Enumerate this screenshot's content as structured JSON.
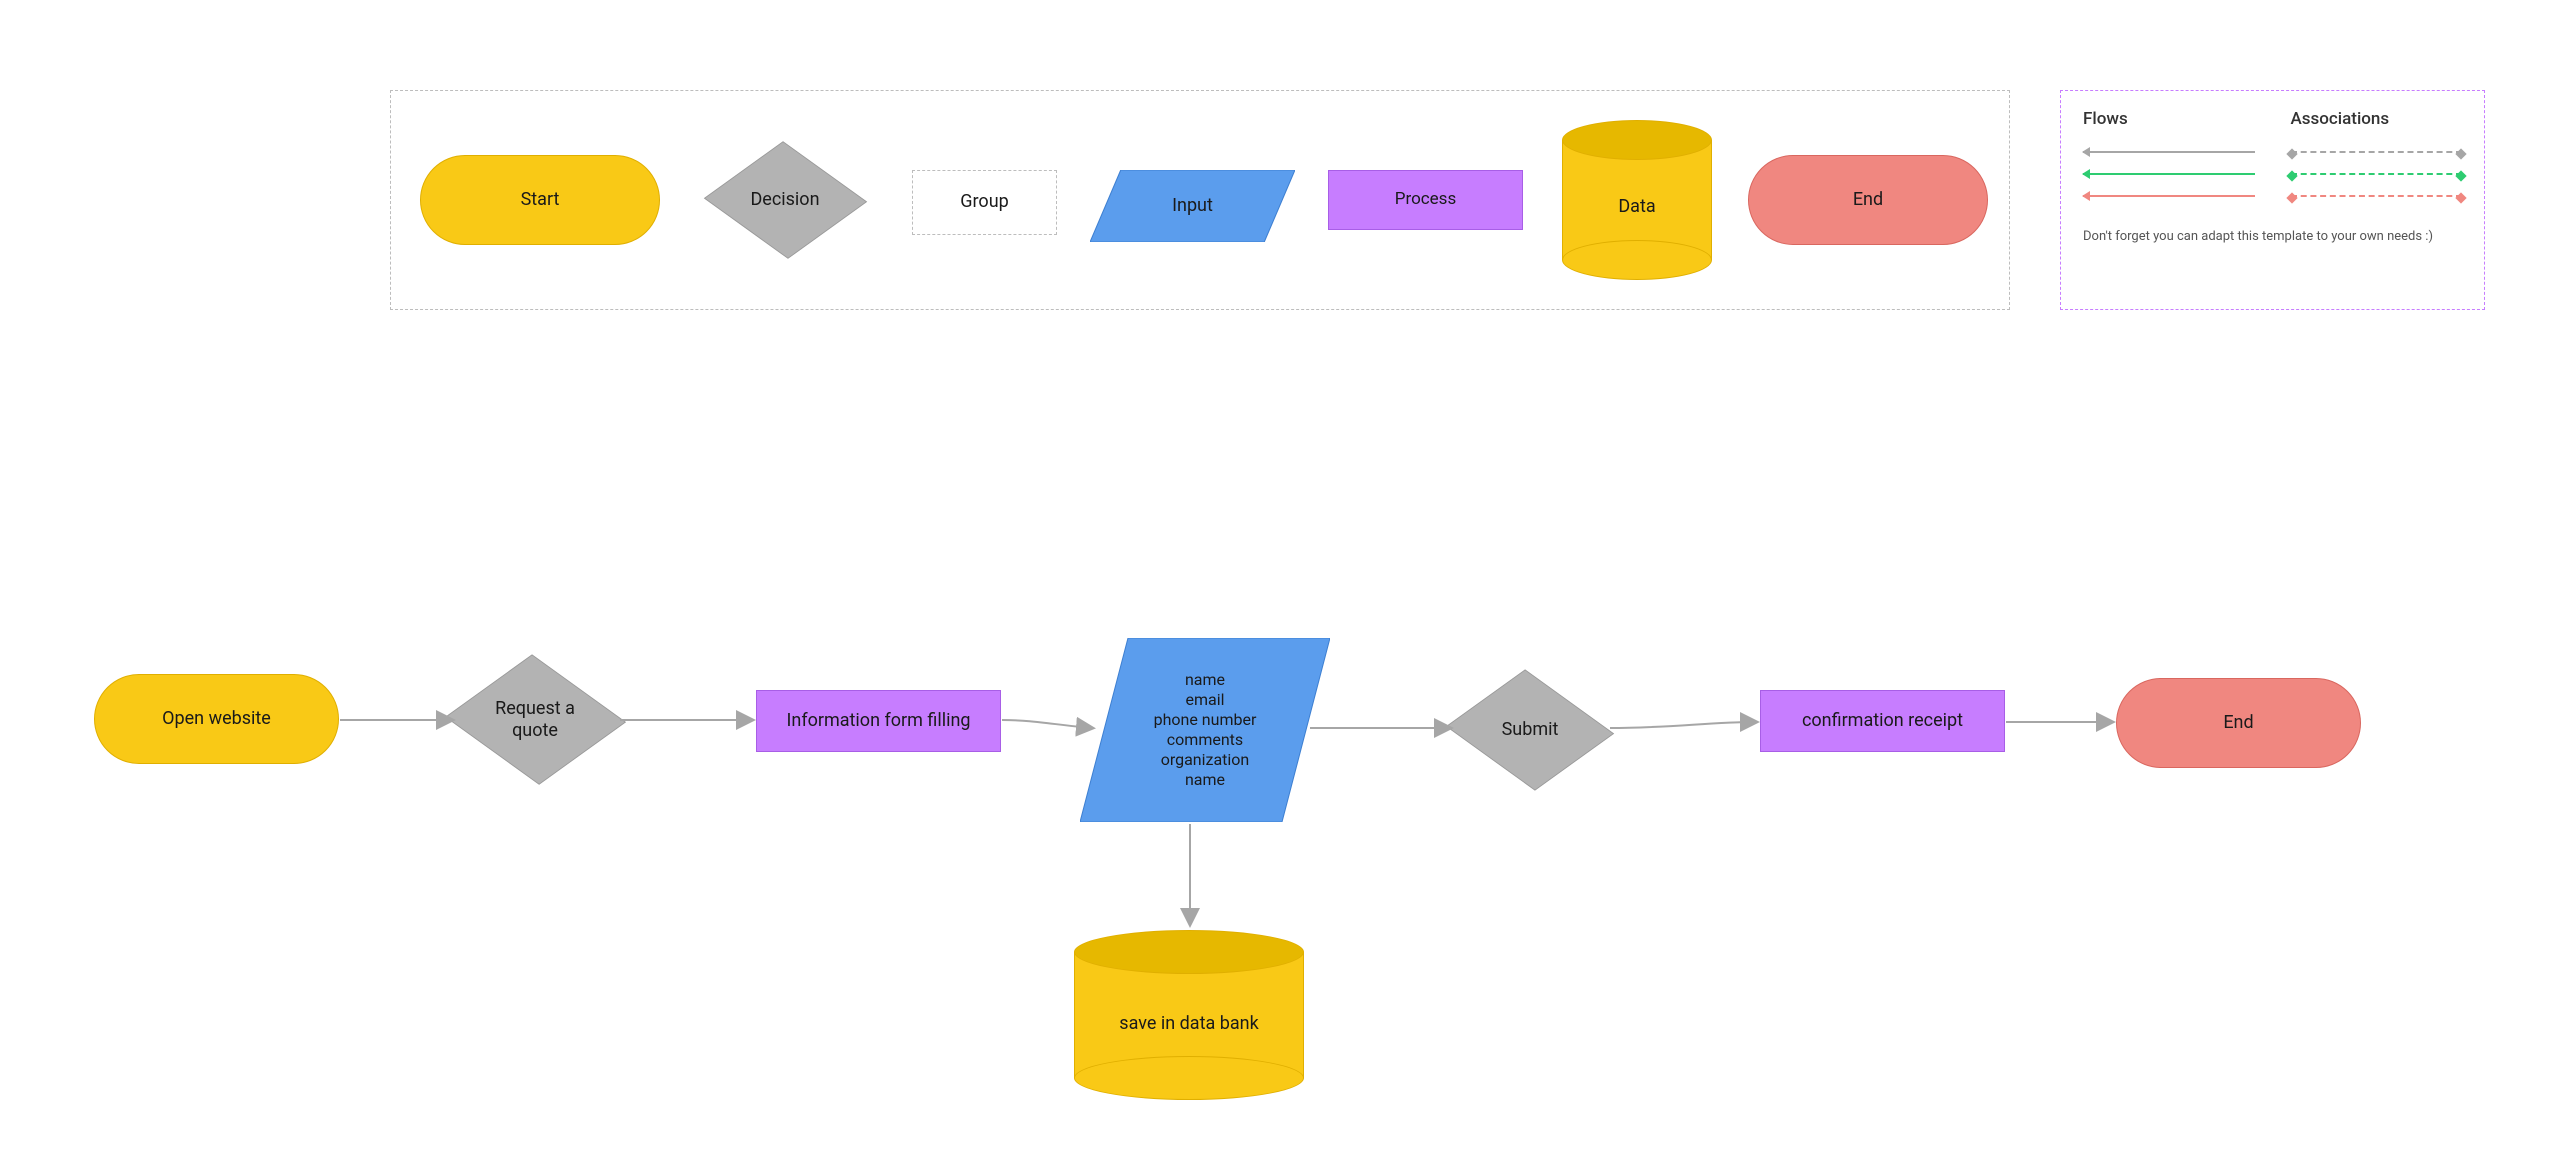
{
  "legend": {
    "shapes": {
      "start": "Start",
      "decision": "Decision",
      "group": "Group",
      "input": "Input",
      "process": "Process",
      "data": "Data",
      "end": "End"
    },
    "info": {
      "flows_header": "Flows",
      "associations_header": "Associations",
      "note": "Don't forget you can adapt this template to your own needs :)"
    }
  },
  "flow": {
    "open_website": "Open website",
    "request_quote": "Request a\nquote",
    "info_form": "Information form filling",
    "input_fields": "name\nemail\nphone number\ncomments\norganization\nname",
    "submit": "Submit",
    "confirmation": "confirmation receipt",
    "end": "End",
    "data_bank": "save in data bank"
  },
  "colors": {
    "flow_gray": "#a6a6a6",
    "flow_green": "#2ecc71",
    "flow_red": "#f08780"
  }
}
